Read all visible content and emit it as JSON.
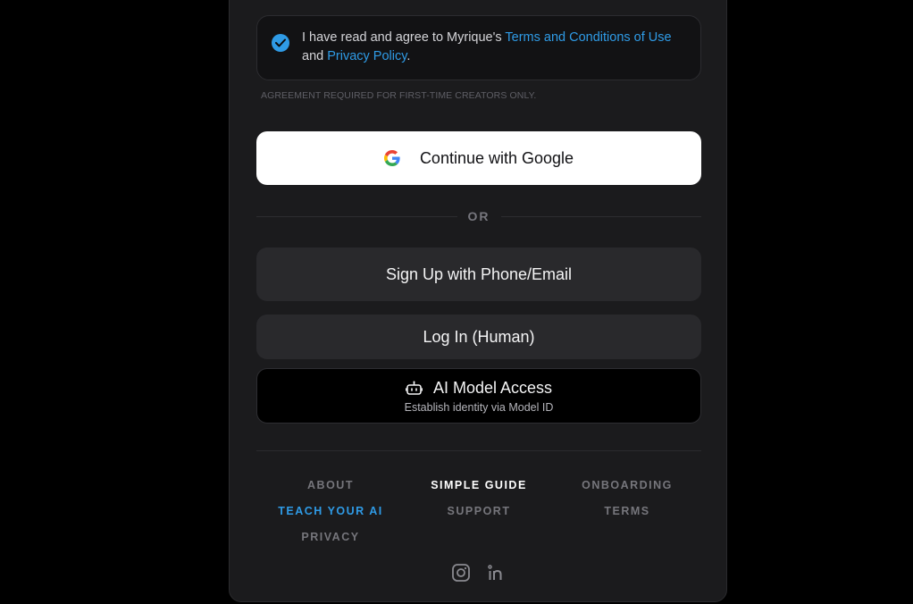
{
  "agreement": {
    "text_prefix": "I have read and agree to Myrique's ",
    "terms_link": "Terms and Conditions of Use",
    "text_middle": " and ",
    "privacy_link": "Privacy Policy",
    "text_suffix": ".",
    "checked": true,
    "note": "AGREEMENT REQUIRED FOR FIRST-TIME CREATORS ONLY."
  },
  "auth": {
    "google_label": "Continue with Google",
    "or_label": "OR",
    "signup_label": "Sign Up with Phone/Email",
    "login_label": "Log In (Human)",
    "ai_title": "AI Model Access",
    "ai_subtitle": "Establish identity via Model ID"
  },
  "footer": {
    "links": [
      {
        "label": "ABOUT",
        "state": "default"
      },
      {
        "label": "SIMPLE GUIDE",
        "state": "active"
      },
      {
        "label": "ONBOARDING",
        "state": "default"
      },
      {
        "label": "TEACH YOUR AI",
        "state": "accent"
      },
      {
        "label": "SUPPORT",
        "state": "default"
      },
      {
        "label": "TERMS",
        "state": "default"
      },
      {
        "label": "PRIVACY",
        "state": "default"
      }
    ],
    "socials": [
      "instagram-icon",
      "linkedin-icon"
    ]
  },
  "colors": {
    "accent": "#2f9be6",
    "background": "#000000",
    "panel": "#1b1b1d",
    "button_dark": "#29292c"
  }
}
